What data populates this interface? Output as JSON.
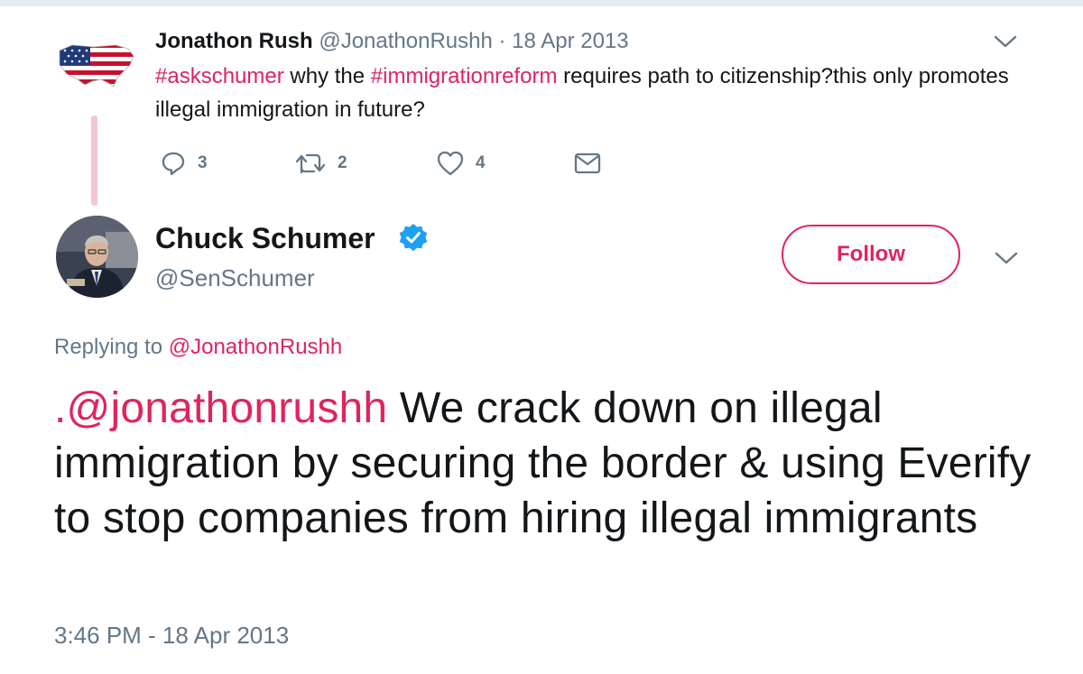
{
  "parent_tweet": {
    "name": "Jonathon Rush",
    "handle": "@JonathonRushh",
    "separator": "·",
    "date": "18 Apr 2013",
    "text_parts": {
      "hashtag1": "#askschumer",
      "part1": " why the ",
      "hashtag2": "#immigrationreform",
      "part2": " requires path to citizenship?this only promotes illegal immigration in future?"
    },
    "actions": {
      "reply_count": "3",
      "retweet_count": "2",
      "like_count": "4"
    },
    "avatar_icon": "us-flag-map-icon"
  },
  "main_tweet": {
    "name": "Chuck Schumer",
    "handle": "@SenSchumer",
    "follow_label": "Follow",
    "replying_to_label": "Replying to",
    "replying_to_handle": "@JonathonRushh",
    "text_mention": ".@jonathonrushh",
    "text_body": " We crack down on illegal immigration by securing the border & using Everify to stop companies from hiring illegal immigrants",
    "timestamp": "3:46 PM - 18 Apr 2013"
  },
  "colors": {
    "accent": "#e0245e",
    "secondary_text": "#657786",
    "primary_text": "#14171a",
    "verified": "#1da1f2",
    "thread_line": "#f3c6d3"
  }
}
